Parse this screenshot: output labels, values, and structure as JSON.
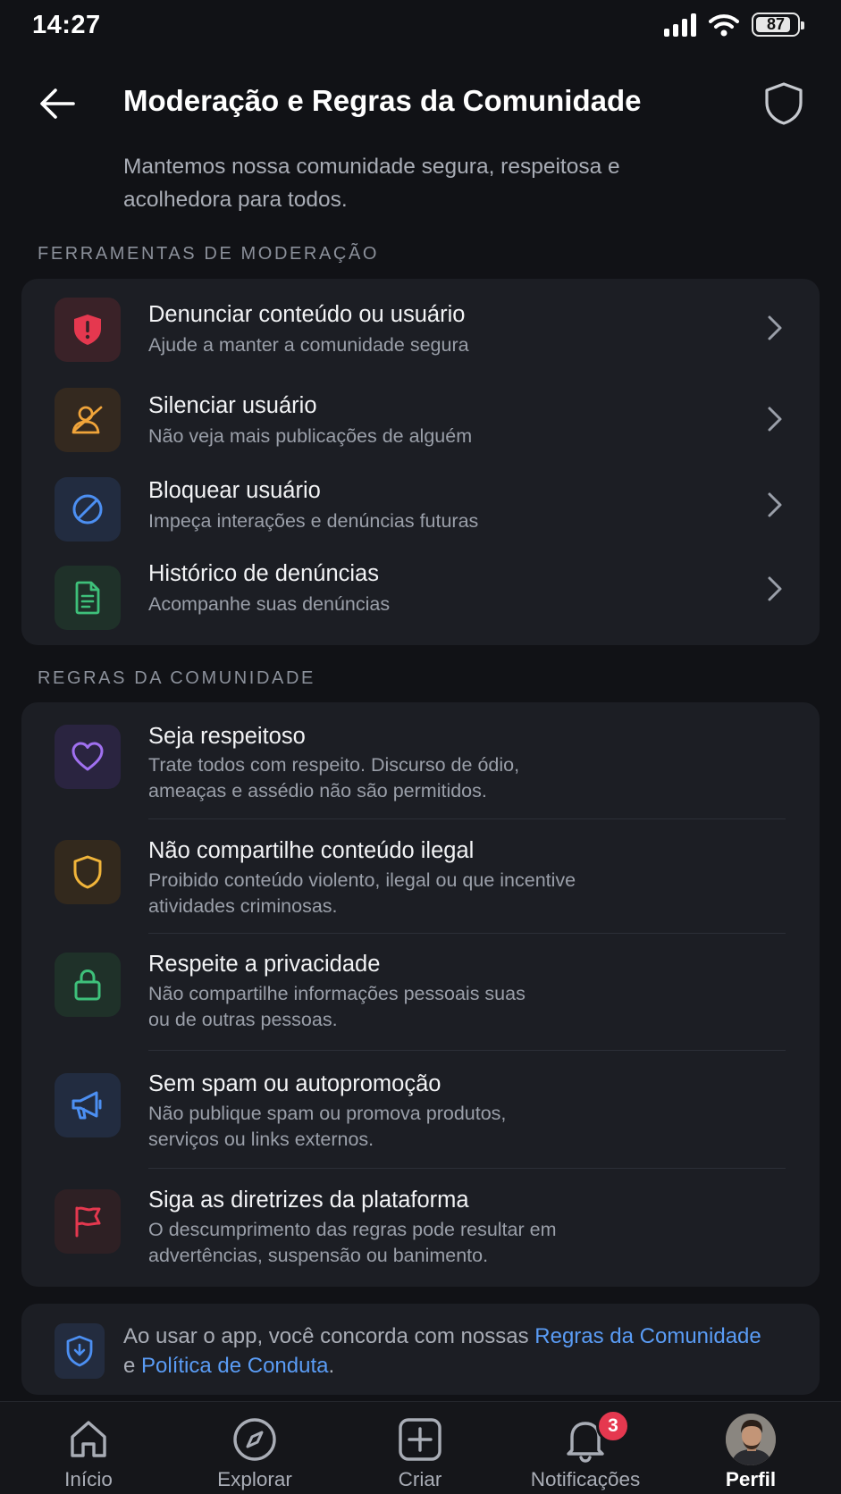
{
  "status_bar": {
    "time": "14:27",
    "battery": "87"
  },
  "header": {
    "title": "Moderação e Regras da Comunidade",
    "subtitle": "Mantemos nossa comunidade segura, respeitosa e acolhedora para todos."
  },
  "tools_section": {
    "label": "FERRAMENTAS DE MODERAÇÃO",
    "items": [
      {
        "title": "Denunciar conteúdo ou usuário",
        "desc": "Ajude a manter a comunidade segura",
        "icon": "shield-alert-icon",
        "color": "#e5384f"
      },
      {
        "title": "Silenciar usuário",
        "desc": "Não veja mais publicações de alguém",
        "icon": "mute-user-icon",
        "color": "#f0a43a"
      },
      {
        "title": "Bloquear usuário",
        "desc": "Impeça interações e denúncias futuras",
        "icon": "block-icon",
        "color": "#4c8ff2"
      },
      {
        "title": "Histórico de denúncias",
        "desc": "Acompanhe suas denúncias",
        "icon": "document-icon",
        "color": "#3ec07a"
      }
    ]
  },
  "rules_section": {
    "label": "REGRAS DA COMUNIDADE",
    "items": [
      {
        "title": "Seja respeitoso",
        "desc1": "Trate todos com respeito. Discurso de ódio,",
        "desc2": "ameaças e assédio não são permitidos.",
        "icon": "heart-icon",
        "color": "#a070f0"
      },
      {
        "title": "Não compartilhe conteúdo ilegal",
        "desc1": "Proibido conteúdo violento, ilegal ou que incentive",
        "desc2": "atividades criminosas.",
        "icon": "shield-icon",
        "color": "#f0b43a"
      },
      {
        "title": "Respeite a privacidade",
        "desc1": "Não compartilhe informações pessoais suas",
        "desc2": "ou de outras pessoas.",
        "icon": "lock-icon",
        "color": "#3ec07a"
      },
      {
        "title": "Sem spam ou autopromoção",
        "desc1": "Não publique spam ou promova produtos,",
        "desc2": "serviços ou links externos.",
        "icon": "megaphone-icon",
        "color": "#4c8ff2"
      },
      {
        "title": "Siga as diretrizes da plataforma",
        "desc1": "O descumprimento das regras pode resultar em",
        "desc2": "advertências, suspensão ou banimento.",
        "icon": "flag-icon",
        "color": "#e5384f"
      }
    ]
  },
  "notice": {
    "text_before": "Ao usar o app, você concorda com nossas ",
    "link1": "Regras da Comunidade",
    "text_middle": " e ",
    "link2": "Política de Conduta",
    "text_after": "."
  },
  "bottom_nav": {
    "items": [
      {
        "label": "Início",
        "icon": "home-icon"
      },
      {
        "label": "Explorar",
        "icon": "compass-icon"
      },
      {
        "label": "Criar",
        "icon": "plus-square-icon"
      },
      {
        "label": "Notificações",
        "icon": "bell-icon",
        "badge": "3"
      },
      {
        "label": "Perfil",
        "icon": "avatar",
        "active": true
      }
    ]
  }
}
